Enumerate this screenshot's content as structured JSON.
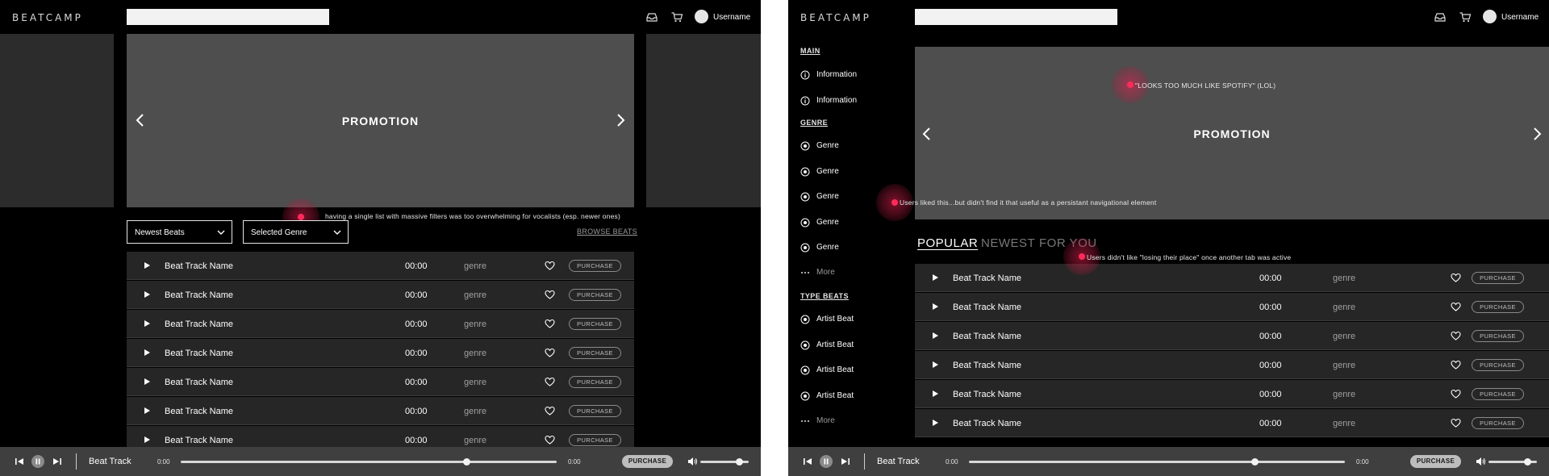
{
  "brand": "BEATCAMP",
  "username": "Username",
  "promo_label": "PROMOTION",
  "left_screen": {
    "filters": {
      "sort": "Newest Beats",
      "genre": "Selected Genre",
      "browse_link": "BROWSE BEATS"
    },
    "annotation": "having a single list with massive filters was too overwhelming for vocalists (esp. newer ones)",
    "tracks": [
      {
        "name": "Beat Track Name",
        "duration": "00:00",
        "genre": "genre",
        "action": "PURCHASE"
      },
      {
        "name": "Beat Track Name",
        "duration": "00:00",
        "genre": "genre",
        "action": "PURCHASE"
      },
      {
        "name": "Beat Track Name",
        "duration": "00:00",
        "genre": "genre",
        "action": "PURCHASE"
      },
      {
        "name": "Beat Track Name",
        "duration": "00:00",
        "genre": "genre",
        "action": "PURCHASE"
      },
      {
        "name": "Beat Track Name",
        "duration": "00:00",
        "genre": "genre",
        "action": "PURCHASE"
      },
      {
        "name": "Beat Track Name",
        "duration": "00:00",
        "genre": "genre",
        "action": "PURCHASE"
      },
      {
        "name": "Beat Track Name",
        "duration": "00:00",
        "genre": "genre",
        "action": "PURCHASE"
      }
    ]
  },
  "right_screen": {
    "sidebar": {
      "main_heading": "MAIN",
      "main_items": [
        "Information",
        "Information"
      ],
      "genre_heading": "GENRE",
      "genre_items": [
        "Genre",
        "Genre",
        "Genre",
        "Genre",
        "Genre"
      ],
      "more_label": "More",
      "type_heading": "TYPE BEATS",
      "type_items": [
        "Artist Beat",
        "Artist Beat",
        "Artist Beat",
        "Artist Beat"
      ]
    },
    "tabs": [
      "POPULAR",
      "NEWEST",
      "FOR YOU"
    ],
    "annotations": {
      "promo": "\"LOOKS TOO MUCH LIKE SPOTIFY\" (LOL)",
      "sidebar": "Users liked this...but didn't find it that useful as a persistant navigational element",
      "tabs": "Users didn't like \"losing their place\" once another tab was active"
    },
    "tracks": [
      {
        "name": "Beat Track Name",
        "duration": "00:00",
        "genre": "genre",
        "action": "PURCHASE"
      },
      {
        "name": "Beat Track Name",
        "duration": "00:00",
        "genre": "genre",
        "action": "PURCHASE"
      },
      {
        "name": "Beat Track Name",
        "duration": "00:00",
        "genre": "genre",
        "action": "PURCHASE"
      },
      {
        "name": "Beat Track Name",
        "duration": "00:00",
        "genre": "genre",
        "action": "PURCHASE"
      },
      {
        "name": "Beat Track Name",
        "duration": "00:00",
        "genre": "genre",
        "action": "PURCHASE"
      },
      {
        "name": "Beat Track Name",
        "duration": "00:00",
        "genre": "genre",
        "action": "PURCHASE"
      }
    ]
  },
  "player": {
    "track": "Beat Track",
    "time_start": "0:00",
    "time_end": "0:00",
    "progress": 0.76,
    "volume": 0.8,
    "purchase": "PURCHASE"
  },
  "icons": {
    "header": [
      "inbox-icon",
      "cart-icon",
      "avatar"
    ],
    "player": [
      "skip-back-icon",
      "pause-icon",
      "skip-forward-icon",
      "volume-icon"
    ],
    "track": [
      "play-icon",
      "heart-icon"
    ],
    "sidebar": [
      "info-icon",
      "target-icon",
      "dots-icon"
    ]
  },
  "colors": {
    "background": "#000000",
    "surface": "#262626",
    "promo": "#4e4e4e",
    "player": "#3f3f3f",
    "hotspot": "#ff2b5a"
  }
}
